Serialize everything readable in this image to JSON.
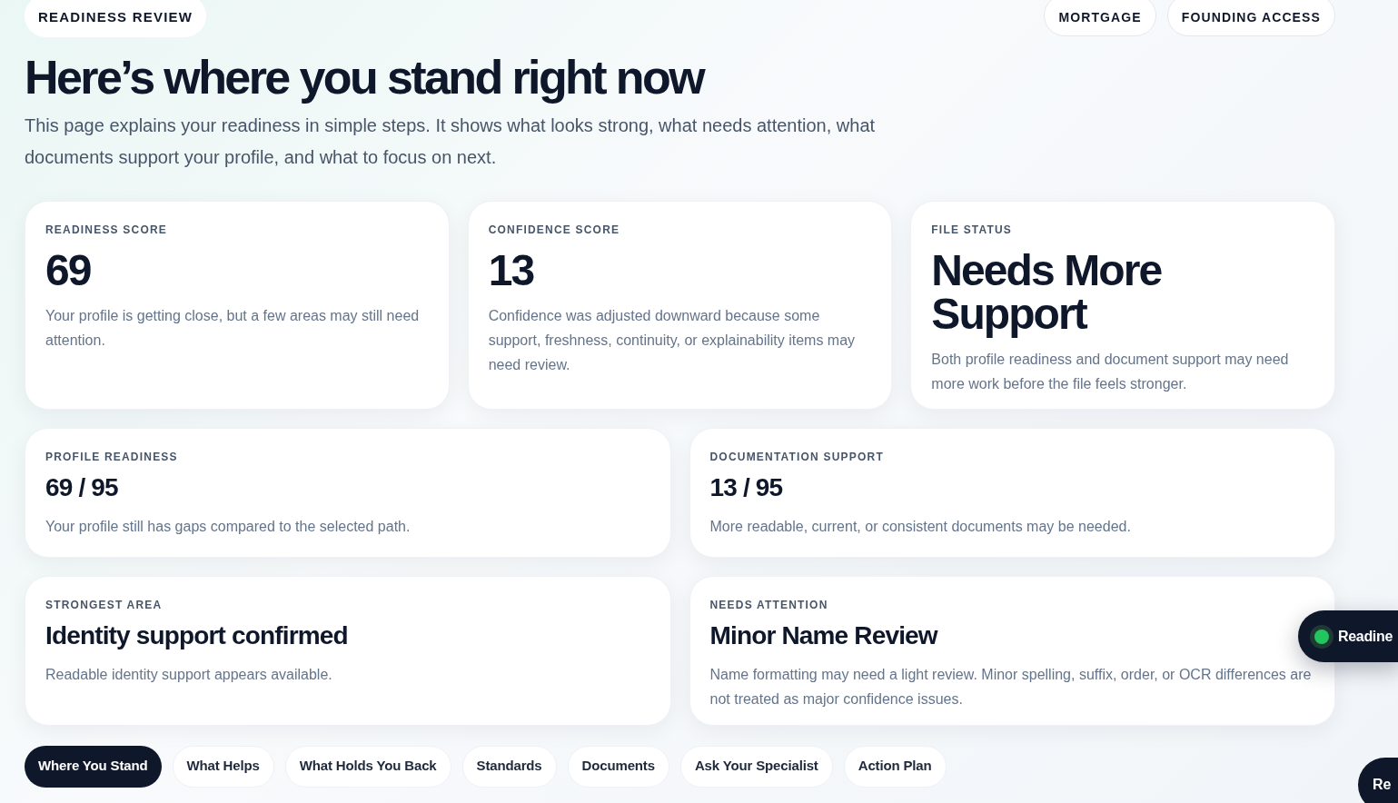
{
  "eyebrow": "READINESS REVIEW",
  "badges": [
    "MORTGAGE",
    "FOUNDING ACCESS"
  ],
  "title": "Here’s where you stand right now",
  "intro": "This page explains your readiness in simple steps. It shows what looks strong, what needs attention, what documents support your profile, and what to focus on next.",
  "score_cards": [
    {
      "label": "READINESS SCORE",
      "value": "69",
      "text": "Your profile is getting close, but a few areas may still need attention."
    },
    {
      "label": "CONFIDENCE SCORE",
      "value": "13",
      "text": "Confidence was adjusted downward because some support, freshness, continuity, or explainability items may need review."
    },
    {
      "label": "FILE STATUS",
      "value": "Needs More Support",
      "text": "Both profile readiness and document support may need more work before the file feels stronger."
    }
  ],
  "progress_cards": [
    {
      "label": "PROFILE READINESS",
      "value": "69 / 95",
      "text": "Your profile still has gaps compared to the selected path."
    },
    {
      "label": "DOCUMENTATION SUPPORT",
      "value": "13 / 95",
      "text": "More readable, current, or consistent documents may be needed."
    }
  ],
  "area_cards": [
    {
      "label": "STRONGEST AREA",
      "value": "Identity support confirmed",
      "text": "Readable identity support appears available."
    },
    {
      "label": "NEEDS ATTENTION",
      "value": "Minor Name Review",
      "text": "Name formatting may need a light review. Minor spelling, suffix, order, or OCR differences are not treated as major confidence issues."
    }
  ],
  "tabs": [
    {
      "label": "Where You Stand",
      "selected": true
    },
    {
      "label": "What Helps",
      "selected": false
    },
    {
      "label": "What Holds You Back",
      "selected": false
    },
    {
      "label": "Standards",
      "selected": false
    },
    {
      "label": "Documents",
      "selected": false
    },
    {
      "label": "Ask Your Specialist",
      "selected": false
    },
    {
      "label": "Action Plan",
      "selected": false
    }
  ],
  "floating_status": {
    "label": "Readine",
    "color": "#22c55e"
  },
  "floating_button": {
    "label": "Re"
  }
}
